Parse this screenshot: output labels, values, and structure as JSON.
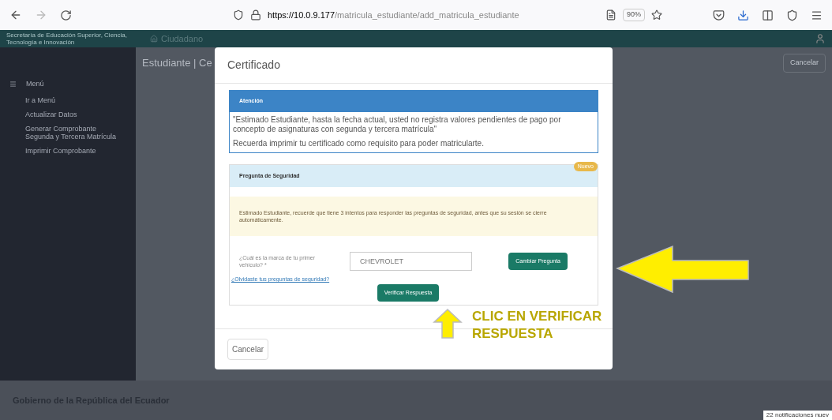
{
  "browser": {
    "url_host": "https://10.0.9.177",
    "url_path": "/matricula_estudiante/add_matricula_estudiante",
    "zoom": "90%"
  },
  "app_header": {
    "org": "Secretaría de Educación Superior, Ciencia, Tecnología e Innovación",
    "breadcrumb": "Ciudadano"
  },
  "sidebar": {
    "menu_label": "Menú",
    "items": [
      {
        "label": "Ir a Menú"
      },
      {
        "label": "Actualizar Datos"
      },
      {
        "label": "Generar Comprobante Segunda y Tercera Matrícula"
      },
      {
        "label": "Imprimir Comprobante"
      }
    ]
  },
  "page": {
    "title": "Estudiante | Ce",
    "action_button": "Cancelar"
  },
  "footer": {
    "text": "Gobierno de la República del Ecuador"
  },
  "modal": {
    "title": "Certificado",
    "alert": {
      "heading": "Atención",
      "message": "\"Estimado Estudiante, hasta la fecha actual, usted no registra valores pendientes de pago por concepto de asignaturas con segunda y tercera matrícula\"",
      "reminder": "Recuerda imprimir tu certificado como requisito para poder matricularte."
    },
    "security": {
      "heading": "Pregunta de Seguridad",
      "badge": "Nuevo",
      "warning": "Estimado Estudiante, recuerde que tiene 3 intentos para responder las preguntas de seguridad, antes que su sesión se cierre automáticamente.",
      "question": "¿Cuál es la marca de tu primer vehículo? *",
      "answer": "CHEVROLET",
      "change_button": "Cambiar Pregunta",
      "forgot_link": "¿Olvidaste tus preguntas de seguridad?",
      "verify_button": "Verificar Respuesta"
    },
    "cancel_button": "Cancelar"
  },
  "annotation": {
    "text": "CLIC EN VERIFICAR RESPUESTA"
  },
  "notification": "22 notificaciones nuev"
}
